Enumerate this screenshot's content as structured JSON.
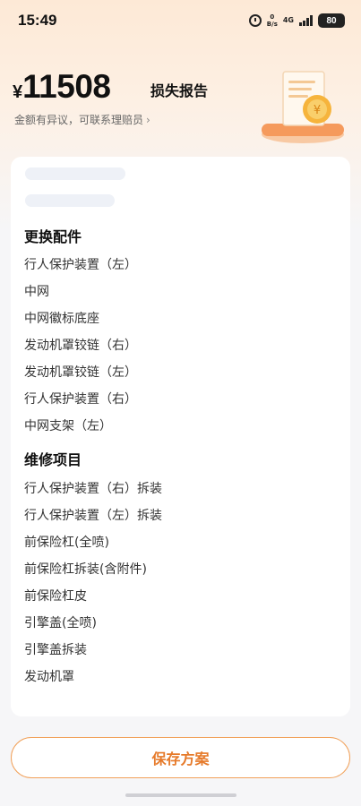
{
  "status_bar": {
    "time": "15:49",
    "net_speed_value": "0",
    "net_speed_unit": "B/s",
    "network": "4G",
    "battery": "80"
  },
  "summary": {
    "currency": "¥",
    "amount": "11508",
    "report_title": "损失报告",
    "contact_text": "金额有异议，可联系理赔员",
    "contact_chevron": "›"
  },
  "sections": {
    "parts_title": "更换配件",
    "parts": [
      "行人保护装置（左）",
      "中网",
      "中网徽标底座",
      "发动机罩铰链（右）",
      "发动机罩铰链（左）",
      "行人保护装置（右）",
      "中网支架（左）"
    ],
    "repairs_title": "维修项目",
    "repairs": [
      "行人保护装置（右）拆装",
      "行人保护装置（左）拆装",
      "前保险杠(全喷)",
      "前保险杠拆装(含附件)",
      "前保险杠皮",
      "引擎盖(全喷)",
      "引擎盖拆装",
      "发动机罩"
    ]
  },
  "actions": {
    "save_label": "保存方案"
  },
  "colors": {
    "accent": "#e67a2a",
    "header_bg": "#fde9d6"
  }
}
